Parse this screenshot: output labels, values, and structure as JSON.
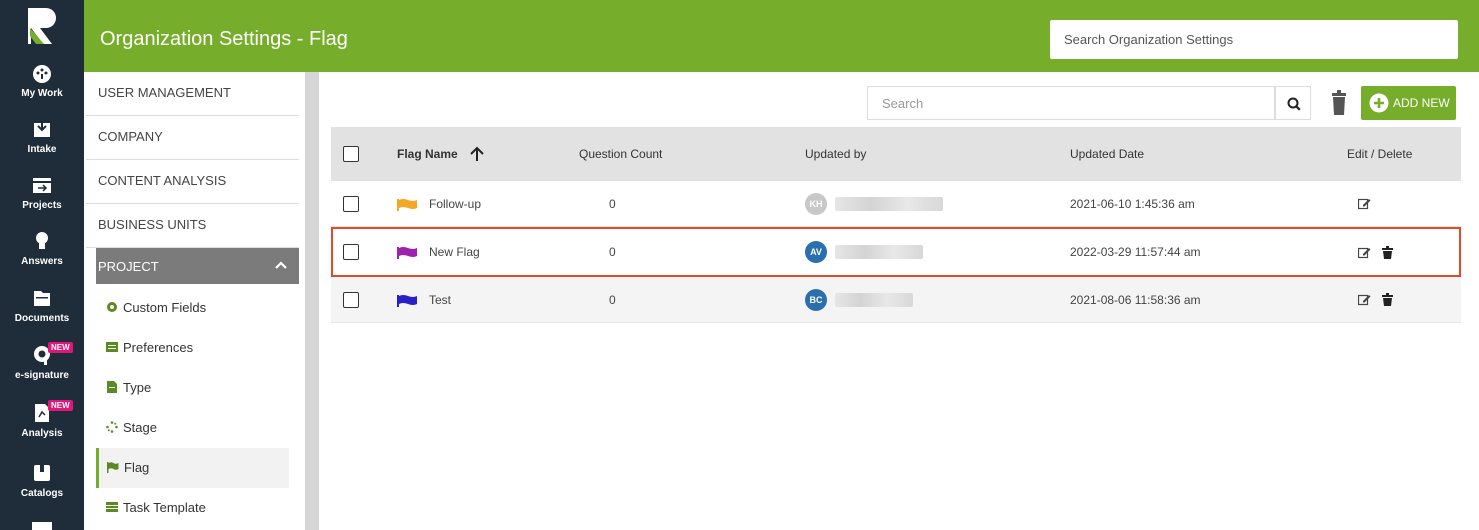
{
  "rail": {
    "items": [
      {
        "label": "My Work",
        "icon": "dashboard-icon"
      },
      {
        "label": "Intake",
        "icon": "intake-icon"
      },
      {
        "label": "Projects",
        "icon": "projects-icon"
      },
      {
        "label": "Answers",
        "icon": "lightbulb-icon"
      },
      {
        "label": "Documents",
        "icon": "documents-icon"
      },
      {
        "label": "e-signature",
        "icon": "esignature-icon",
        "badge": "NEW"
      },
      {
        "label": "Analysis",
        "icon": "analysis-icon",
        "badge": "NEW"
      },
      {
        "label": "Catalogs",
        "icon": "catalogs-icon"
      }
    ]
  },
  "header": {
    "title": "Organization Settings - Flag",
    "search_placeholder": "Search Organization Settings"
  },
  "nav": {
    "items": [
      "USER MANAGEMENT",
      "COMPANY",
      "CONTENT ANALYSIS",
      "BUSINESS UNITS"
    ],
    "project": "PROJECT",
    "sub_items": [
      {
        "label": "Custom Fields",
        "icon": "gear-icon"
      },
      {
        "label": "Preferences",
        "icon": "preferences-icon"
      },
      {
        "label": "Type",
        "icon": "document-icon"
      },
      {
        "label": "Stage",
        "icon": "spinner-icon"
      },
      {
        "label": "Flag",
        "icon": "flag-icon",
        "active": true
      },
      {
        "label": "Task Template",
        "icon": "template-icon"
      }
    ]
  },
  "toolbar": {
    "search_placeholder": "Search",
    "add_label": "ADD NEW"
  },
  "table": {
    "columns": [
      "Flag Name",
      "Question Count",
      "Updated by",
      "Updated Date",
      "Edit / Delete"
    ],
    "rows": [
      {
        "flag_name": "Follow-up",
        "flag_color": "#f5a623",
        "question_count": "0",
        "avatar": "KH",
        "avatar_color": "#c8c8c8",
        "updated_date": "2021-06-10 1:45:36 am",
        "deletable": false
      },
      {
        "flag_name": "New Flag",
        "flag_color": "#a020b0",
        "question_count": "0",
        "avatar": "AV",
        "avatar_color": "#2a6fae",
        "updated_date": "2022-03-29 11:57:44 am",
        "deletable": true,
        "highlighted": true
      },
      {
        "flag_name": "Test",
        "flag_color": "#2a20c8",
        "question_count": "0",
        "avatar": "BC",
        "avatar_color": "#2a6fae",
        "updated_date": "2021-08-06 11:58:36 am",
        "deletable": true
      }
    ]
  },
  "colors": {
    "accent": "#76ad2b",
    "rail": "#1f2c3a",
    "highlight_border": "#e04b2a"
  }
}
